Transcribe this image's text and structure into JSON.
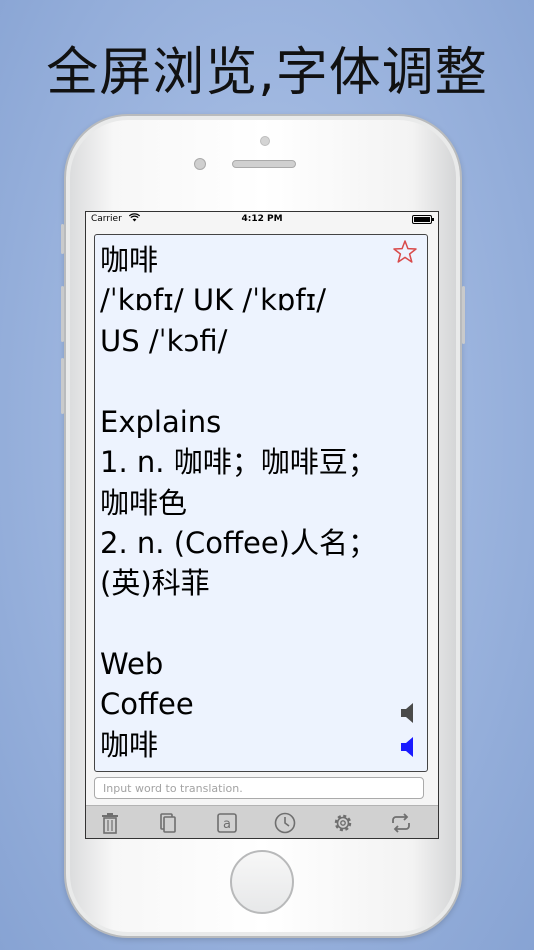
{
  "headline": "全屏浏览,字体调整",
  "status_bar": {
    "carrier": "Carrier",
    "time": "4:12 PM"
  },
  "result": {
    "word": "咖啡",
    "phonetic": " /ˈkɒfɪ/  UK /ˈkɒfɪ/",
    "phonetic_us": "US /ˈkɔfi/",
    "explains_heading": "Explains",
    "explains_lines": [
      "1. n. 咖啡；咖啡豆；",
      "咖啡色",
      "2. n. (Coffee)人名；",
      "(英)科菲"
    ],
    "web_heading": "Web",
    "web_lines": [
      "Coffee",
      "咖啡"
    ]
  },
  "input": {
    "placeholder": "Input word to translation."
  },
  "toolbar": {
    "items": [
      "trash-icon",
      "copy-icon",
      "clipboard-a-icon",
      "clock-icon",
      "gear-icon",
      "repeat-icon"
    ]
  },
  "colors": {
    "background": "#9fb7e0",
    "word": "#1a1add",
    "section": "#8c8c8c",
    "star": "#d94b4b",
    "speaker_active": "#1a1aff"
  }
}
